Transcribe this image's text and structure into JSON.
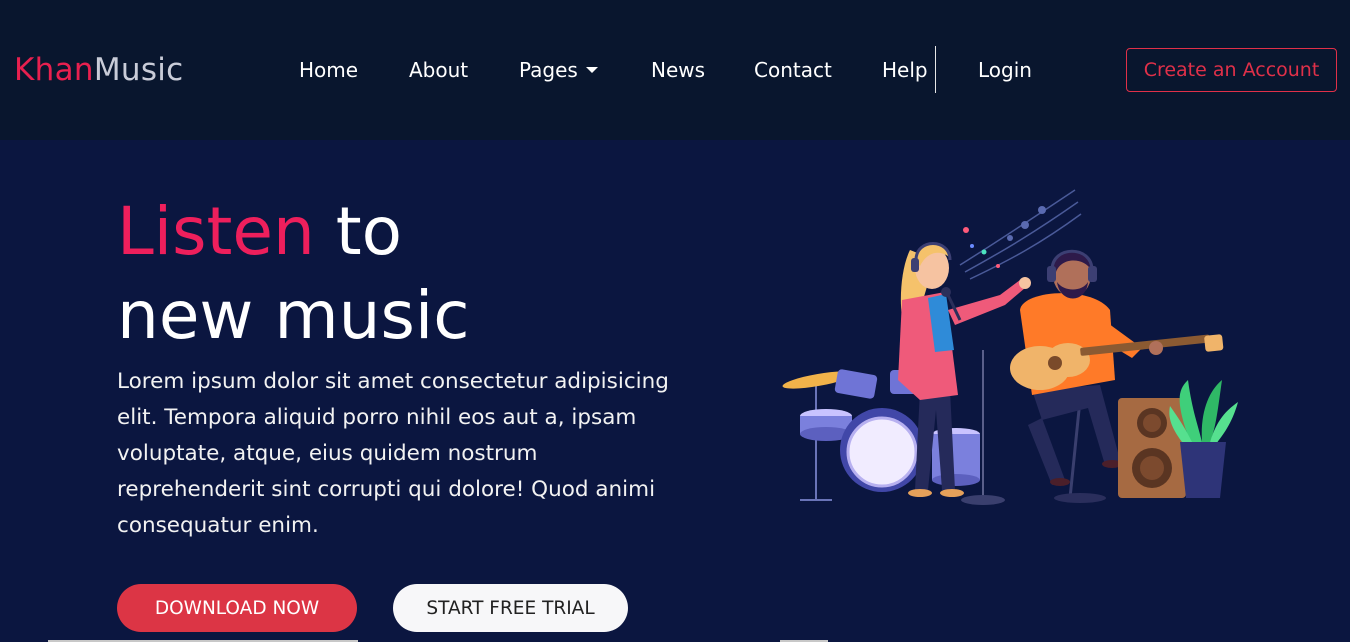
{
  "brand": {
    "part1": "Khan",
    "part2": "Music"
  },
  "nav": {
    "home": "Home",
    "about": "About",
    "pages": "Pages",
    "news": "News",
    "contact": "Contact",
    "help": "Help",
    "login": "Login",
    "create_account": "Create an Account"
  },
  "hero": {
    "title_accent": "Listen",
    "title_rest1": "to",
    "title_line2": "new music",
    "body": "Lorem ipsum dolor sit amet consectetur adipisicing elit. Tempora aliquid porro nihil eos aut a, ipsam voluptate, atque, eius quidem nostrum reprehenderit sint corrupti qui dolore! Quod animi consequatur enim.",
    "download_label": "DOWNLOAD NOW",
    "trial_label": "START FREE TRIAL"
  },
  "icons": {
    "pages_dropdown": "caret-down-icon",
    "illustration": "musicians-illustration"
  },
  "colors": {
    "navbar_bg": "#09162e",
    "page_bg": "#0b1640",
    "brand_accent": "#e8204f",
    "title_accent": "#ee1f5c",
    "download_button": "#dc3545",
    "account_button": "#e03049"
  }
}
